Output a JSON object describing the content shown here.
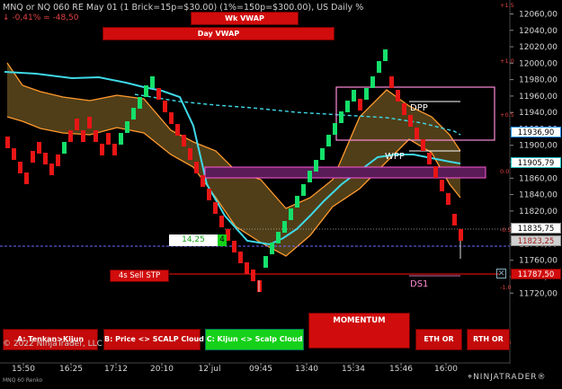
{
  "header": {
    "title": "MNQ or NQ 060 RE May 01 (1 Brick=15p=$30.00) (1%=150p=$300.00), US Daily %",
    "change": "↓ -0,41% = -48,50"
  },
  "banners": {
    "wk_vwap": "Wk VWAP",
    "day_vwap": "Day VWAP"
  },
  "price_axis": {
    "ticks": [
      "12060,00",
      "12040,00",
      "12020,00",
      "12000,00",
      "11980,00",
      "11960,00",
      "11940,00",
      "11920,00",
      "11900,00",
      "11880,00",
      "11860,00",
      "11840,00",
      "11820,00",
      "11800,00",
      "11780,00",
      "11760,00",
      "11740,00",
      "11720,00"
    ],
    "labels": [
      {
        "value": "11936,90",
        "bg": "#ffffff",
        "fg": "#000000",
        "border": "#1e90ff"
      },
      {
        "value": "11905,79",
        "bg": "#ffffff",
        "fg": "#000000",
        "border": "#20c0c0"
      },
      {
        "value": "11835,75",
        "bg": "#ffffff",
        "fg": "#000000",
        "border": "#888888"
      },
      {
        "value": "11823,25",
        "bg": "#d0d0d0",
        "fg": "#a02020",
        "border": "#888888"
      },
      {
        "value": "11787,50",
        "bg": "#d10c0c",
        "fg": "#ffffff",
        "border": "#700000"
      }
    ]
  },
  "pct_axis": [
    "+1.5",
    "+1.0",
    "+0.5",
    "0.0",
    "-0.5",
    "-1.0",
    "-1.5"
  ],
  "time_axis": [
    "15:50",
    "16:25",
    "17:12",
    "20:10",
    "12 jul",
    "09:45",
    "13:40",
    "15:34",
    "15:46",
    "16:00"
  ],
  "annotations": {
    "dpp": "DPP",
    "wpp": "WPP",
    "ds1": "DS1",
    "box_14": "14,25",
    "box_4": "4",
    "sell_stp": "4s  Sell STP"
  },
  "buttons": {
    "a": "A: Tenkan>Kijun",
    "b": "B: Price <> SCALP Cloud",
    "c": "C: Kijun <> Scalp Cloud",
    "momentum": "MOMENTUM",
    "eth": "ETH OR",
    "rth": "RTH OR"
  },
  "footer": {
    "copyright": "© 2022 NinjaTrader, LLC",
    "instrument": "MNQ 60 Renko",
    "logo": "⌖NINJATRADER®"
  },
  "colors": {
    "bull": "#15e06a",
    "bear": "#e81515",
    "cyan_line": "#3fd9e8",
    "orange_line": "#ff9a2e",
    "cloud": "#6b5320",
    "accent_red": "#d10c0c"
  }
}
